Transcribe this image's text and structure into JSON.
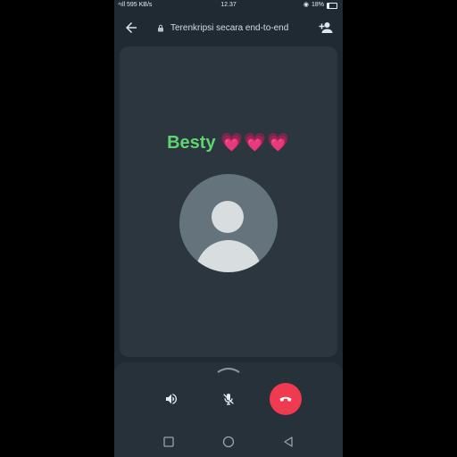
{
  "status_bar": {
    "network_speed": "595 KB/s",
    "time": "12.37",
    "battery": "18%"
  },
  "header": {
    "encryption_label": "Terenkripsi secara end-to-end",
    "back_icon": "arrow-left-icon",
    "add_participant_icon": "person-add-icon"
  },
  "call": {
    "contact_name": "Besty",
    "name_emojis": "💗💗💗",
    "avatar_icon": "default-person-avatar"
  },
  "controls": {
    "speaker_icon": "volume-icon",
    "mic_icon": "mic-off-icon",
    "end_call_icon": "phone-hangup-icon",
    "end_call_color": "#f03a4f"
  },
  "colors": {
    "accent_name": "#5fd471",
    "background": "#1f2a32",
    "card": "#2b363e"
  }
}
